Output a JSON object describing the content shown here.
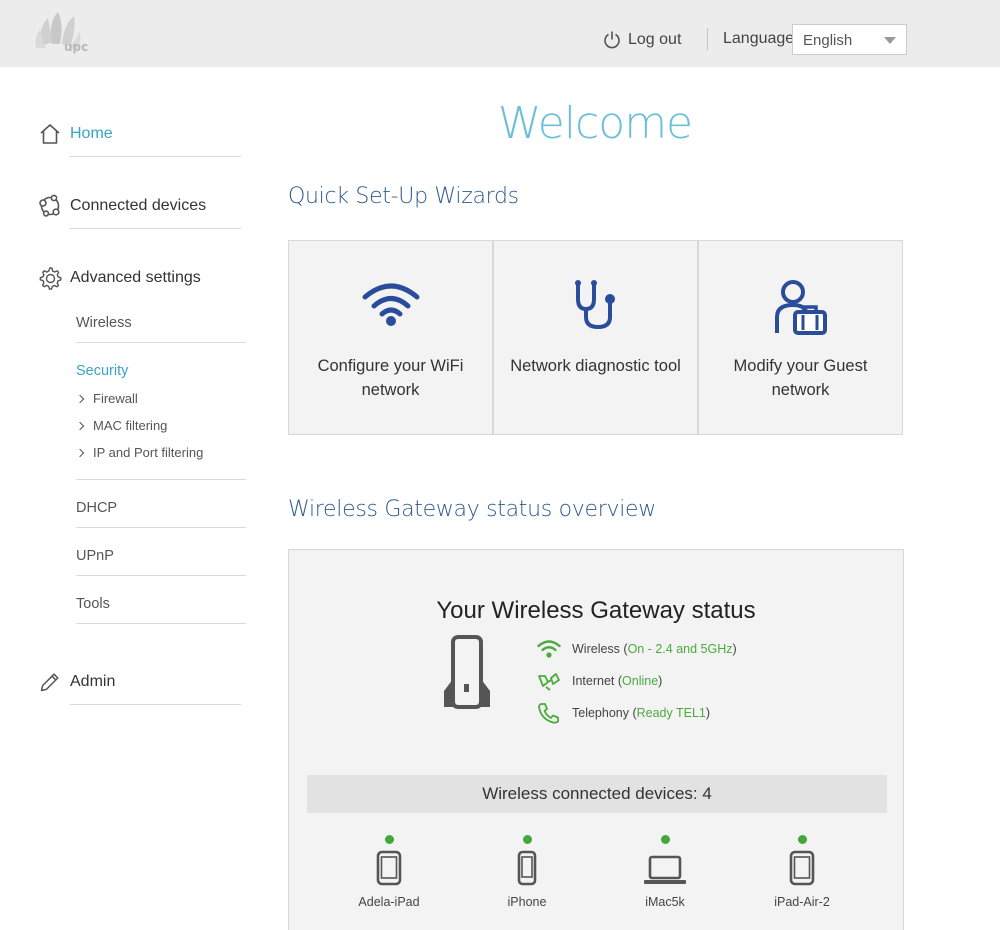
{
  "header": {
    "logo_text": "upc",
    "logout_label": "Log out",
    "language_label": "Language",
    "language_value": "English"
  },
  "sidebar": {
    "home": "Home",
    "connected_devices": "Connected devices",
    "advanced_settings": "Advanced settings",
    "sub_items": [
      "Wireless",
      "Security",
      "DHCP",
      "UPnP",
      "Tools"
    ],
    "security_items": [
      "Firewall",
      "MAC filtering",
      "IP and Port filtering"
    ],
    "admin": "Admin"
  },
  "main": {
    "welcome": "Welcome",
    "wizards_title": "Quick Set-Up Wizards",
    "wizards": [
      {
        "label": "Configure your WiFi network",
        "icon": "wifi-icon"
      },
      {
        "label": "Network diagnostic tool",
        "icon": "stethoscope-icon"
      },
      {
        "label": "Modify your Guest network",
        "icon": "guest-user-icon"
      }
    ],
    "overview_title": "Wireless Gateway status overview",
    "status": {
      "title": "Your Wireless Gateway status",
      "wireless_label": "Wireless (",
      "wireless_value": "On - 2.4 and 5GHz",
      "internet_label": "Internet (",
      "internet_value": "Online",
      "telephony_label": "Telephony (",
      "telephony_value": "Ready TEL1",
      "close_paren": ")",
      "connected_devices": "Wireless connected devices: 4",
      "devices": [
        {
          "name": "Adela-iPad",
          "type": "tablet"
        },
        {
          "name": "iPhone",
          "type": "phone"
        },
        {
          "name": "iMac5k",
          "type": "laptop"
        },
        {
          "name": "iPad-Air-2",
          "type": "tablet"
        }
      ]
    }
  },
  "colors": {
    "accent": "#3aa3c6",
    "title_blue": "#2f5a8c",
    "icon_blue": "#2a4d9b",
    "status_green": "#4aaa3c"
  }
}
